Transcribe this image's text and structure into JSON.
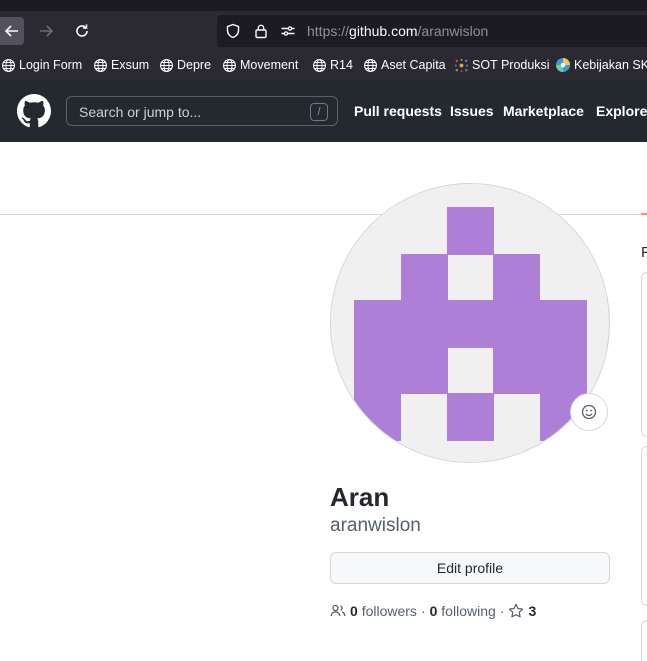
{
  "browser": {
    "url_prefix": "https://",
    "url_host": "github.com",
    "url_path": "/aranwislon",
    "bookmarks": [
      {
        "label": "Login Form",
        "icon": "globe-icon"
      },
      {
        "label": "Exsum",
        "icon": "globe-icon"
      },
      {
        "label": "Depre",
        "icon": "globe-icon"
      },
      {
        "label": "Movement",
        "icon": "globe-icon"
      },
      {
        "label": "R14",
        "icon": "globe-icon"
      },
      {
        "label": "Aset Capita",
        "icon": "globe-icon"
      },
      {
        "label": "SOT Produksi",
        "icon": "sot-favicon"
      },
      {
        "label": "Kebijakan SKK",
        "icon": "kebijakan-favicon"
      }
    ]
  },
  "github_header": {
    "search_placeholder": "Search or jump to...",
    "search_shortcut": "/",
    "nav": [
      "Pull requests",
      "Issues",
      "Marketplace",
      "Explore"
    ]
  },
  "profile": {
    "name": "Aran",
    "username": "aranwislon",
    "edit_label": "Edit profile",
    "followers_count": "0",
    "followers_label": "followers",
    "separator": "·",
    "following_count": "0",
    "following_label": "following",
    "stars_count": "3",
    "avatar_color": "#ad7fd6",
    "avatar_bg": "#f0f0f0"
  },
  "side_panel": {
    "heading_fragment": "P"
  }
}
